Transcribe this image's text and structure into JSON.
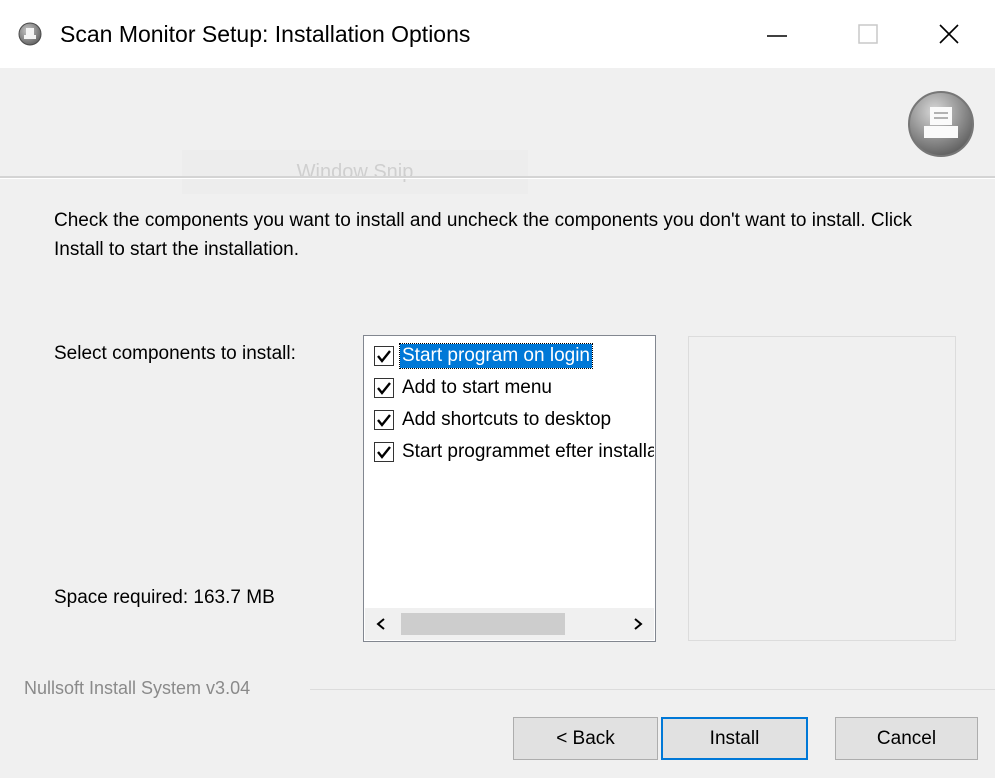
{
  "window": {
    "title": "Scan Monitor Setup: Installation Options",
    "icon": "installer-disc-icon",
    "controls": {
      "minimize": "minimize-icon",
      "maximize": "maximize-icon",
      "close": "close-icon"
    }
  },
  "header": {
    "logo": "printer-disc-icon",
    "ghost_text": "Window Snip"
  },
  "body": {
    "intro": "Check the components you want to install and uncheck the components you don't want to install. Click Install to start the installation.",
    "select_label": "Select components to install:",
    "space_required": "Space required: 163.7 MB"
  },
  "components": [
    {
      "label": "Start program on login",
      "checked": true,
      "selected": true
    },
    {
      "label": "Add to start menu",
      "checked": true,
      "selected": false
    },
    {
      "label": "Add shortcuts to desktop",
      "checked": true,
      "selected": false
    },
    {
      "label": "Start programmet efter installation",
      "checked": true,
      "selected": false
    }
  ],
  "footer": {
    "brand": "Nullsoft Install System v3.04",
    "back_label": "< Back",
    "install_label": "Install",
    "cancel_label": "Cancel"
  },
  "colors": {
    "accent": "#0078d7",
    "selection": "#0078d7"
  }
}
